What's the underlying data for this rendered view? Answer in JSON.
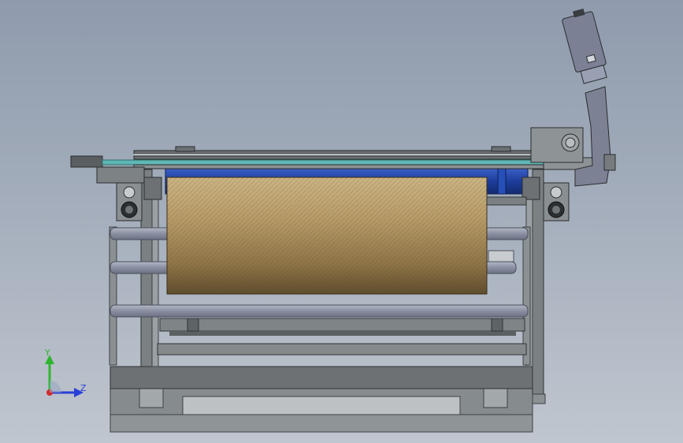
{
  "viewport": {
    "background_top": "#8f9bad",
    "background_bottom": "#c0c6cf"
  },
  "triad": {
    "y_label": "Y",
    "z_label": "Z",
    "y_color": "#2fb52f",
    "z_color": "#2a3fd6",
    "x_color": "#d22a2a"
  },
  "colors": {
    "frame": "#6d7173",
    "frame_dark": "#3e4244",
    "frame_light": "#9aa0a3",
    "roller_bar": "#9096a6",
    "blue_roller": "#1e3f9e",
    "teal_strip": "#5fb7b5",
    "fabric_light": "#c2a978",
    "fabric_dark": "#6e5a36",
    "sensor": "#7c8094"
  }
}
